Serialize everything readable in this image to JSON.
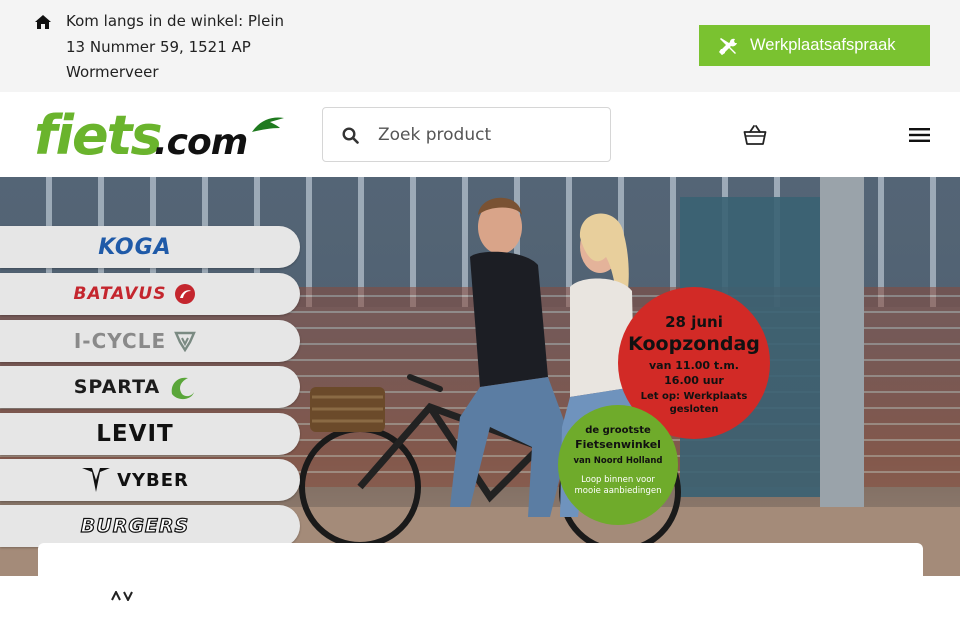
{
  "topbar": {
    "address_lines": [
      "Kom langs in de winkel: Plein",
      "13 Nummer 59, 1521 AP",
      "Wormerveer"
    ],
    "appointment_label": "Werkplaatsafspraak",
    "appointment_color": "#7ac230"
  },
  "header": {
    "logo_text": "fiets.com",
    "search_placeholder": "Zoek product",
    "icons": [
      "search-icon",
      "shopping-basket-icon",
      "hamburger-menu-icon"
    ]
  },
  "hero": {
    "brands": [
      {
        "name": "KOGA"
      },
      {
        "name": "BATAVUS"
      },
      {
        "name": "I-CYCLE"
      },
      {
        "name": "SPARTA"
      },
      {
        "name": "LEVIT"
      },
      {
        "name": "VYBER"
      },
      {
        "name": "BURGERS"
      }
    ],
    "red_badge": {
      "date": "28 juni",
      "title": "Koopzondag",
      "hours_from": "van 11.00 t.m.",
      "hours_to": "16.00 uur",
      "note": "Let op: Werkplaats gesloten",
      "color": "#d22a26"
    },
    "green_badge": {
      "line1": "de grootste",
      "line2": "Fietsenwinkel",
      "line3": "van Noord Holland",
      "line4": "Loop binnen voor mooie aanbiedingen",
      "color": "#6fab2b"
    }
  }
}
